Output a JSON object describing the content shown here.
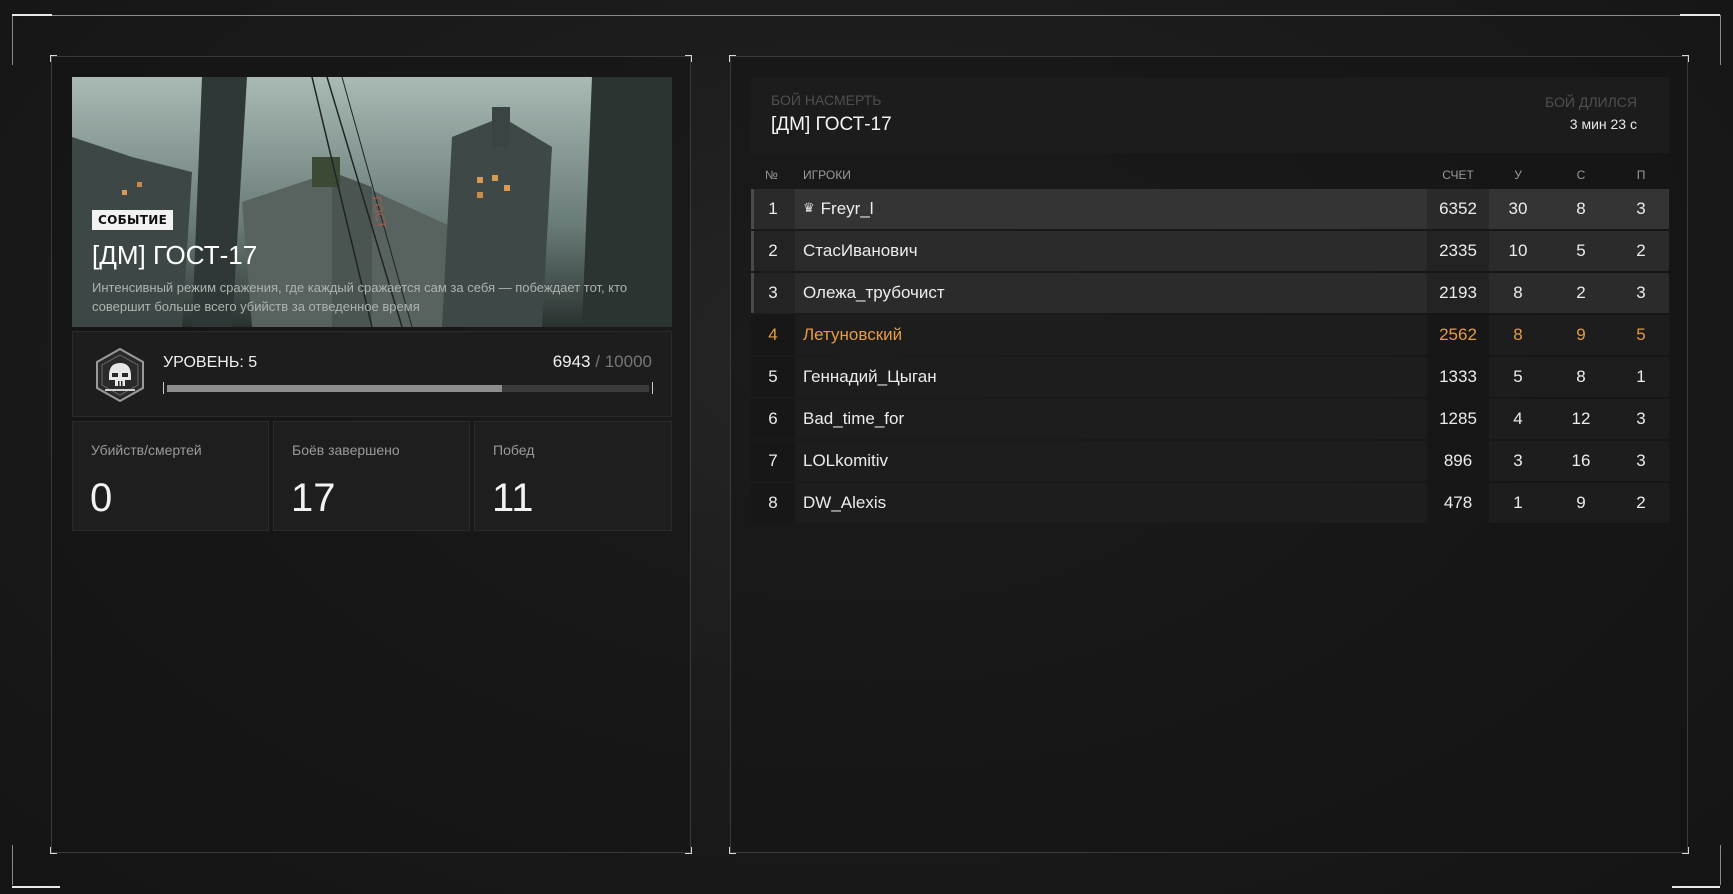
{
  "event": {
    "badge": "СОБЫТИЕ",
    "title": "[ДМ] ГОСТ-17",
    "description": "Интенсивный режим сражения, где каждый сражается сам за себя — побеждает тот, кто совершит больше всего убийств за отведенное время"
  },
  "level": {
    "label": "УРОВЕНЬ: 5",
    "xp_current": "6943",
    "xp_separator": "/",
    "xp_max": "10000",
    "progress_fraction": 0.6943,
    "icon": "skull-helmet-icon"
  },
  "stats": [
    {
      "label": "Убийств/смертей",
      "value": "0"
    },
    {
      "label": "Боёв завершено",
      "value": "17"
    },
    {
      "label": "Побед",
      "value": "11"
    }
  ],
  "match": {
    "mode_label": "БОЙ НАСМЕРТЬ",
    "title": "[ДМ] ГОСТ-17",
    "duration_label": "БОЙ ДЛИЛСЯ",
    "duration_value": "3 мин 23 с"
  },
  "columns": {
    "num": "№",
    "players": "ИГРОКИ",
    "score": "СЧЕТ",
    "kills": "У",
    "deaths": "С",
    "assists": "П"
  },
  "players": [
    {
      "num": "1",
      "name": "Freyr_l",
      "score": "6352",
      "k": "30",
      "d": "8",
      "a": "3",
      "crown": true
    },
    {
      "num": "2",
      "name": "СтасИванович",
      "score": "2335",
      "k": "10",
      "d": "5",
      "a": "2"
    },
    {
      "num": "3",
      "name": "Олежа_трубочист",
      "score": "2193",
      "k": "8",
      "d": "2",
      "a": "3"
    },
    {
      "num": "4",
      "name": "Летуновский",
      "score": "2562",
      "k": "8",
      "d": "9",
      "a": "5",
      "current_user": true
    },
    {
      "num": "5",
      "name": "Геннадий_Цыган",
      "score": "1333",
      "k": "5",
      "d": "8",
      "a": "1"
    },
    {
      "num": "6",
      "name": "Bad_time_for",
      "score": "1285",
      "k": "4",
      "d": "12",
      "a": "3"
    },
    {
      "num": "7",
      "name": "LOLkomitiv",
      "score": "896",
      "k": "3",
      "d": "16",
      "a": "3"
    },
    {
      "num": "8",
      "name": "DW_Alexis",
      "score": "478",
      "k": "1",
      "d": "9",
      "a": "2"
    }
  ],
  "colors": {
    "accent_current_user": "#e59a45",
    "background": "#1c1c1c"
  }
}
